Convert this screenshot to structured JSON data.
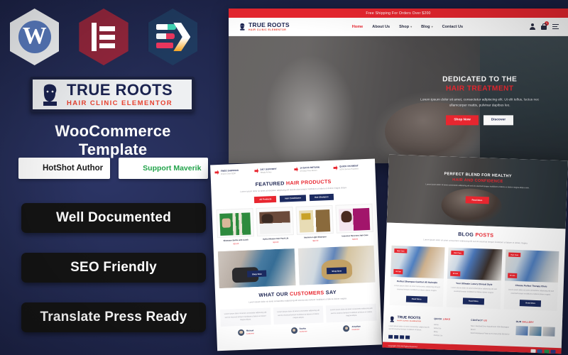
{
  "theme": {
    "bg_navy": "#1b2145",
    "accent_red": "#e8262f",
    "deep_navy": "#1b2a60",
    "pill_black": "#141414"
  },
  "badges": {
    "wordpress": {
      "icon": "wordpress-icon",
      "glyph": "W"
    },
    "elementor": {
      "icon": "elementor-icon"
    },
    "elementskit": {
      "icon": "elementskit-icon"
    }
  },
  "logo": {
    "title": "TRUE ROOTS",
    "subtitle": "HAIR CLINIC ELEMENTOR",
    "icon": "bearded-man-icon"
  },
  "headline": "WooCommerce Template",
  "author_badges": [
    {
      "label": "HotShot Author",
      "icon": "flame-shield-icon"
    },
    {
      "label": "Support Maverik",
      "icon": "headset-hexagon-icon"
    }
  ],
  "features": [
    {
      "label": "Well Documented"
    },
    {
      "label": "SEO Friendly"
    },
    {
      "label": "Translate Press Ready"
    }
  ],
  "preview_hero": {
    "announcement": "Free Shipping For Orders Over $200",
    "nav": [
      {
        "label": "Home",
        "active": true,
        "caret": ""
      },
      {
        "label": "About Us",
        "active": false,
        "caret": ""
      },
      {
        "label": "Shop",
        "active": false,
        "caret": "▾"
      },
      {
        "label": "Blog",
        "active": false,
        "caret": "▾"
      },
      {
        "label": "Contact Us",
        "active": false,
        "caret": ""
      }
    ],
    "icons": {
      "user": "user-icon",
      "cart": "cart-icon",
      "cart_count": "0",
      "menu": "hamburger-icon"
    },
    "title_line1": "DEDICATED TO THE",
    "title_line2": "HAIR TREATMENT",
    "paragraph": "Lorem ipsum dolor sit amet, consectetur adipiscing elit. Ut elit tellus, luctus nec ullamcorper mattis, pulvinar dapibus leo.",
    "btn_primary": "Shop Now",
    "btn_secondary": "Discover"
  },
  "preview_products": {
    "feature_strip": [
      {
        "title": "FREE SHIPPING",
        "sub": "Orders Over $200"
      },
      {
        "title": "24/7 SUPPORT",
        "sub": "Ready At Any"
      },
      {
        "title": "14 DAYS RETURN",
        "sub": "30 Days Free Return"
      },
      {
        "title": "QUICK PAYMENT",
        "sub": "100% Secure Payment"
      }
    ],
    "section_title_a": "FEATURED ",
    "section_title_b": "HAIR PRODUCTS",
    "section_desc": "Lorem ipsum dolor sit amet consectetur adipiscing elit sed do eius tempor incididunt ut labore et dolore magna aliqua.",
    "filters": [
      "All Products",
      "Hair Conditioner",
      "Hair Shampoo"
    ],
    "products": [
      {
        "name": "Shampoo Bottle with Comb",
        "price": "$25.00"
      },
      {
        "name": "Hydra Masque Hair Pack Lib",
        "price": "$19.00"
      },
      {
        "name": "Moisture Light Shampoo",
        "price": "$32.00"
      },
      {
        "name": "Intensive Recovery Hair Care",
        "price": "$28.00"
      }
    ],
    "tiles": [
      {
        "btn": "Shop Now"
      },
      {
        "btn": "Shop Now"
      }
    ],
    "testimonial_title_a": "WHAT OUR ",
    "testimonial_title_b": "CUSTOMERS",
    "testimonial_title_c": " SAY",
    "testimonial_desc": "Lorem ipsum dolor sit amet consectetur adipiscing elit sed do eius tempor incididunt ut labore dolore magna.",
    "testimonials": [
      {
        "quote": "Lorem ipsum dolor sit amet consectetur adipiscing elit sed do eiusmod tempor incididunt ut labore et dolore magna aliqua.",
        "name": "Michael",
        "role": "Customer"
      },
      {
        "quote": "Lorem ipsum dolor sit amet consectetur adipiscing elit sed do eiusmod tempor incididunt ut labore et dolore magna aliqua.",
        "name": "Sophia",
        "role": "Customer"
      },
      {
        "quote": "Lorem ipsum dolor sit amet consectetur adipiscing elit sed do eiusmod tempor incididunt ut labore et dolore magna aliqua.",
        "name": "Jonathan",
        "role": "Customer"
      }
    ]
  },
  "preview_blog": {
    "hero_title_a": "PERFECT BLEND FOR HEALTHY",
    "hero_title_b": "HAIR AND CONFIDENCE",
    "hero_desc": "Lorem ipsum dolor sit amet consectetur adipiscing elit sed do eiusmod tempor incididunt ut labore et dolore magna aliqua enim.",
    "hero_btn": "Read More",
    "blog_title_a": "BLOG ",
    "blog_title_b": "POSTS",
    "blog_desc": "Lorem ipsum dolor sit amet consectetur adipiscing elit sed do eiusmod tempor incididunt ut labore et dolore magna.",
    "posts": [
      {
        "tag": "Hair Care",
        "date": "24 Jan",
        "title": "Perfect Shampoo Comfort All Hairstyle",
        "excerpt": "Lorem ipsum dolor sit amet consectetur adipiscing elit sed eiusmod tempor incididunt ut labore dolore magna.",
        "btn": "Read More"
      },
      {
        "tag": "Hair Care",
        "date": "18 Jan",
        "title": "Your Ultimate Luxury Clinical Style",
        "excerpt": "Lorem ipsum dolor sit amet consectetur adipiscing elit sed eiusmod tempor incididunt ut labore dolore magna.",
        "btn": "Read More"
      },
      {
        "tag": "Hair Care",
        "date": "09 Jan",
        "title": "Choose Perfect Therapy Clinic",
        "excerpt": "Lorem ipsum dolor sit amet consectetur adipiscing elit sed eiusmod tempor incididunt ut labore dolore magna.",
        "btn": "Read More"
      }
    ],
    "footer": {
      "logo_title": "TRUE ROOTS",
      "logo_sub": "HAIR CLINIC ELEMENTOR",
      "about": "Lorem ipsum dolor sit amet consectetur adipiscing elit sed do eiusmod tempor incididunt ut labore.",
      "socials": [
        "facebook-icon",
        "twitter-icon",
        "instagram-icon",
        "youtube-icon"
      ],
      "quick_title_a": "QUICK ",
      "quick_title_b": "LINKS",
      "quick_links": [
        "Home",
        "About Us",
        "Shop",
        "Contact Us"
      ],
      "contact_title_a": "CONTACT ",
      "contact_title_b": "US",
      "contact_lines": [
        "New Lakeland Drive Appartment 1255 Burlington Street",
        "Need Assistance? Mon to Fri Call (420) 555-8472"
      ],
      "gallery_title_a": "OUR ",
      "gallery_title_b": "GALLERY",
      "copyright": "Copyright 2023 All Rights Reserved",
      "payments": [
        "mastercard-icon",
        "visa-icon",
        "paypal-icon",
        "amex-icon"
      ]
    }
  }
}
